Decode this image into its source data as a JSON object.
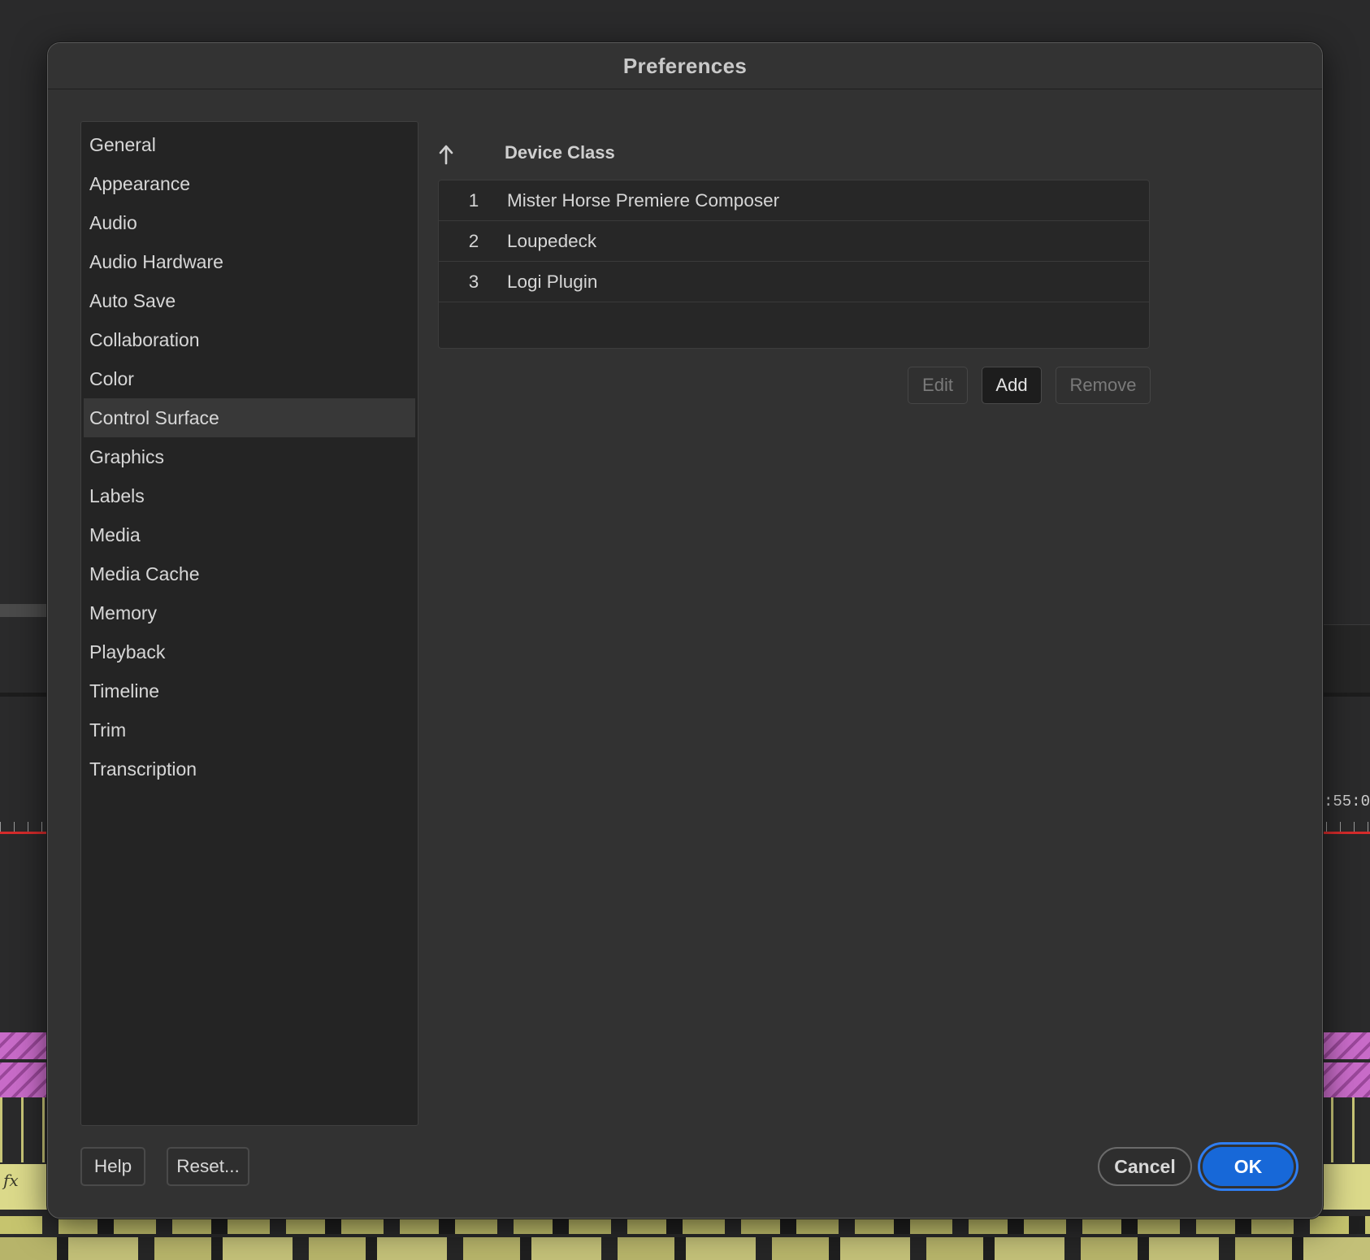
{
  "background": {
    "timecode": "00:55:0"
  },
  "dialog": {
    "title": "Preferences",
    "sidebar": {
      "items": [
        {
          "label": "General"
        },
        {
          "label": "Appearance"
        },
        {
          "label": "Audio"
        },
        {
          "label": "Audio Hardware"
        },
        {
          "label": "Auto Save"
        },
        {
          "label": "Collaboration"
        },
        {
          "label": "Color"
        },
        {
          "label": "Control Surface",
          "selected": true
        },
        {
          "label": "Graphics"
        },
        {
          "label": "Labels"
        },
        {
          "label": "Media"
        },
        {
          "label": "Media Cache"
        },
        {
          "label": "Memory"
        },
        {
          "label": "Playback"
        },
        {
          "label": "Timeline"
        },
        {
          "label": "Trim"
        },
        {
          "label": "Transcription"
        }
      ]
    },
    "control_surface": {
      "sort_icon": "arrow-up-icon",
      "column_header": "Device Class",
      "rows": [
        {
          "num": "1",
          "device": "Mister Horse Premiere Composer"
        },
        {
          "num": "2",
          "device": "Loupedeck"
        },
        {
          "num": "3",
          "device": "Logi Plugin"
        }
      ],
      "buttons": {
        "edit": "Edit",
        "add": "Add",
        "remove": "Remove"
      }
    },
    "footer": {
      "help": "Help",
      "reset": "Reset...",
      "cancel": "Cancel",
      "ok": "OK"
    }
  },
  "colors": {
    "accent": "#1768d8",
    "dialog_bg": "#323232",
    "sidebar_bg": "#242424",
    "selected_item_bg": "#383838"
  }
}
